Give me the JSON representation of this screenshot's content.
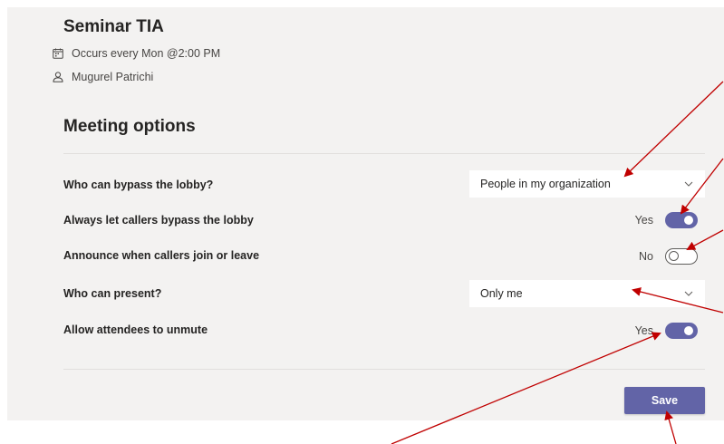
{
  "meeting": {
    "title": "Seminar TIA",
    "recurrence": "Occurs every Mon @2:00 PM",
    "organizer": "Mugurel Patrichi",
    "recurrence_icon": "calendar-icon",
    "organizer_icon": "person-icon"
  },
  "options": {
    "heading": "Meeting options",
    "bypass_lobby": {
      "label": "Who can bypass the lobby?",
      "value": "People in my organization"
    },
    "callers_bypass": {
      "label": "Always let callers bypass the lobby",
      "state": "Yes",
      "on": true
    },
    "announce_callers": {
      "label": "Announce when callers join or leave",
      "state": "No",
      "on": false
    },
    "who_can_present": {
      "label": "Who can present?",
      "value": "Only me"
    },
    "allow_unmute": {
      "label": "Allow attendees to unmute",
      "state": "Yes",
      "on": true
    }
  },
  "actions": {
    "save_label": "Save"
  },
  "colors": {
    "accent": "#6264a7",
    "panel_bg": "#f3f2f1",
    "annotation_arrow": "#c00000"
  }
}
